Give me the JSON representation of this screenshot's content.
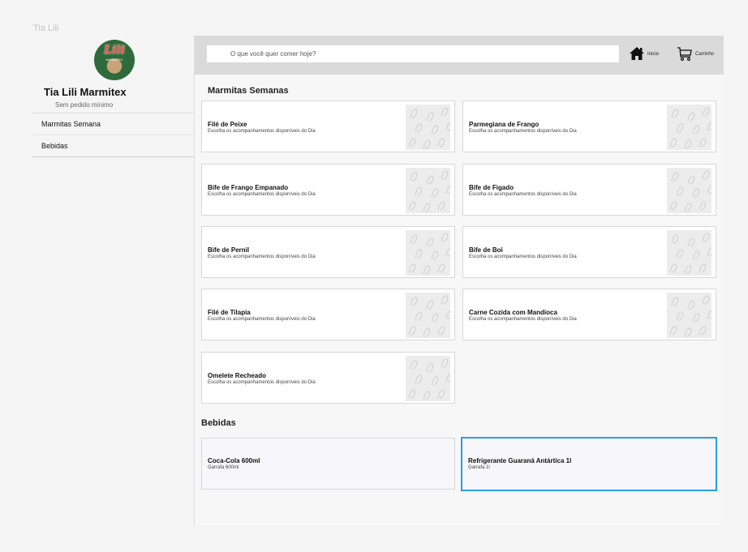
{
  "tab_title": "Tia Lili",
  "sidebar": {
    "logo_text": "Lili",
    "logo_sub": "MARMITEX",
    "store_name": "Tia Lili Marmitex",
    "store_sub": "Sem pedido mínimo",
    "items": [
      {
        "label": "Marmitas Semana"
      },
      {
        "label": "Bebidas"
      }
    ]
  },
  "topbar": {
    "search_placeholder": "O que você quer comer hoje?",
    "home_label": "Inicio",
    "cart_label": "Carrinho",
    "home_icon": "home-icon",
    "cart_icon": "cart-icon"
  },
  "sections": {
    "marmitas_title": "Marmitas Semanas",
    "bebidas_title": "Bebidas"
  },
  "marmitas": [
    {
      "name": "Filé de Peixe",
      "desc": "Escolha os acompanhamentos disponíveis do Dia"
    },
    {
      "name": "Parmegiana de Frango",
      "desc": "Escolha os acompanhamentos disponíveis do Dia"
    },
    {
      "name": "Bife de Frango Empanado",
      "desc": "Escolha os acompanhamentos disponíveis do Dia"
    },
    {
      "name": "Bife de Figado",
      "desc": "Escolha os acompanhamentos disponíveis do Dia"
    },
    {
      "name": "Bife de Pernil",
      "desc": "Escolha os acompanhamentos disponíveis do Dia"
    },
    {
      "name": "Bife de Boi",
      "desc": "Escolha os acompanhamentos disponíveis do Dia"
    },
    {
      "name": "Filé de Tilapia",
      "desc": "Escolha os acompanhamentos disponíveis do Dia"
    },
    {
      "name": "Carne Cozida com Mandioca",
      "desc": "Escolha os acompanhamentos disponíveis do Dia"
    },
    {
      "name": "Omelete Recheado",
      "desc": "Escolha os acompanhamentos disponíveis do Dia"
    }
  ],
  "bebidas": [
    {
      "name": "Coca-Cola 600ml",
      "desc": "Garrafa 600ml"
    },
    {
      "name": "Refrigerante Guaraná Antártica 1l",
      "desc": "Garrafa 1l"
    }
  ],
  "colors": {
    "accent_selected": "#2b9be6",
    "topbar_bg": "#dadada"
  }
}
